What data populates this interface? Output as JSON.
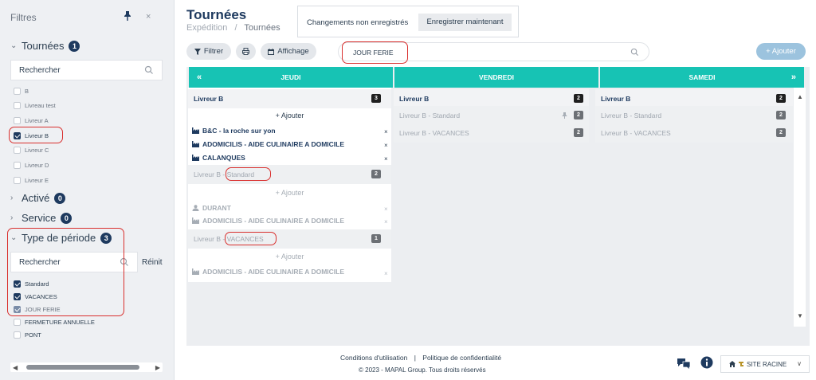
{
  "sidebar": {
    "title": "Filtres",
    "close": "×",
    "tournees": {
      "label": "Tournées",
      "count": "1",
      "search_placeholder": "Rechercher",
      "items": [
        {
          "label": "B",
          "checked": false
        },
        {
          "label": "Livreau test",
          "checked": false
        },
        {
          "label": "Livreur A",
          "checked": false
        },
        {
          "label": "Livreur B",
          "checked": true
        },
        {
          "label": "Livreur C",
          "checked": false
        },
        {
          "label": "Livreur D",
          "checked": false
        },
        {
          "label": "Livreur E",
          "checked": false
        }
      ]
    },
    "active": {
      "label": "Activé",
      "count": "0"
    },
    "service": {
      "label": "Service",
      "count": "0"
    },
    "type_periode": {
      "label": "Type de période",
      "count": "3",
      "search_placeholder": "Rechercher",
      "reset": "Réinit",
      "items": [
        {
          "label": "Standard",
          "checked": true
        },
        {
          "label": "VACANCES",
          "checked": true
        },
        {
          "label": "JOUR FERIE",
          "checked": true
        },
        {
          "label": "FERMETURE ANNUELLE",
          "checked": false
        },
        {
          "label": "PONT",
          "checked": false
        }
      ]
    }
  },
  "header": {
    "title": "Tournées",
    "breadcrumb": [
      "Expédition",
      "/",
      "Tournées"
    ],
    "unsaved_text": "Changements non enregistrés",
    "save_now": "Enregistrer maintenant"
  },
  "toolbar": {
    "filter": "Filtrer",
    "display": "Affichage",
    "search_value": "JOUR FERIE",
    "add": "+ Ajouter"
  },
  "board": {
    "prev": "«",
    "next": "»",
    "columns": [
      "JEUDI",
      "VENDREDI",
      "SAMEDI"
    ],
    "jeudi": {
      "g1": {
        "title": "Livreur B",
        "count": "3",
        "add": "+ Ajouter",
        "entries": [
          "B&C - la roche sur yon",
          "ADOMICILIS - AIDE CULINAIRE A DOMICILE",
          "CALANQUES"
        ]
      },
      "g2": {
        "title": "Livreur B",
        "tag": "Standard",
        "count": "2",
        "add": "+ Ajouter",
        "entries": [
          "DURANT",
          "ADOMICILIS - AIDE CULINAIRE A DOMICILE"
        ]
      },
      "g3": {
        "title": "Livreur B",
        "tag": "- VACANCES",
        "count": "1",
        "add": "+ Ajouter",
        "entries": [
          "ADOMICILIS - AIDE CULINAIRE A DOMICILE"
        ]
      }
    },
    "vendredi": [
      {
        "title": "Livreur B",
        "count": "2"
      },
      {
        "title": "Livreur B  - Standard",
        "count": "2"
      },
      {
        "title": "Livreur B  - VACANCES",
        "count": "2"
      }
    ],
    "samedi": [
      {
        "title": "Livreur B",
        "count": "2"
      },
      {
        "title": "Livreur B  - Standard",
        "count": "2"
      },
      {
        "title": "Livreur B  - VACANCES",
        "count": "2"
      }
    ],
    "remove": "×"
  },
  "footer": {
    "terms": "Conditions d'utilisation",
    "sep": "|",
    "privacy": "Politique de confidentialité",
    "copyright": "© 2023 - MAPAL Group. Tous droits réservés",
    "site": "SITE RACINE"
  },
  "colors": {
    "accent": "#17c3b4",
    "navy": "#1e3a5f",
    "highlight": "#d9302e",
    "add_button": "#9cc3de"
  }
}
